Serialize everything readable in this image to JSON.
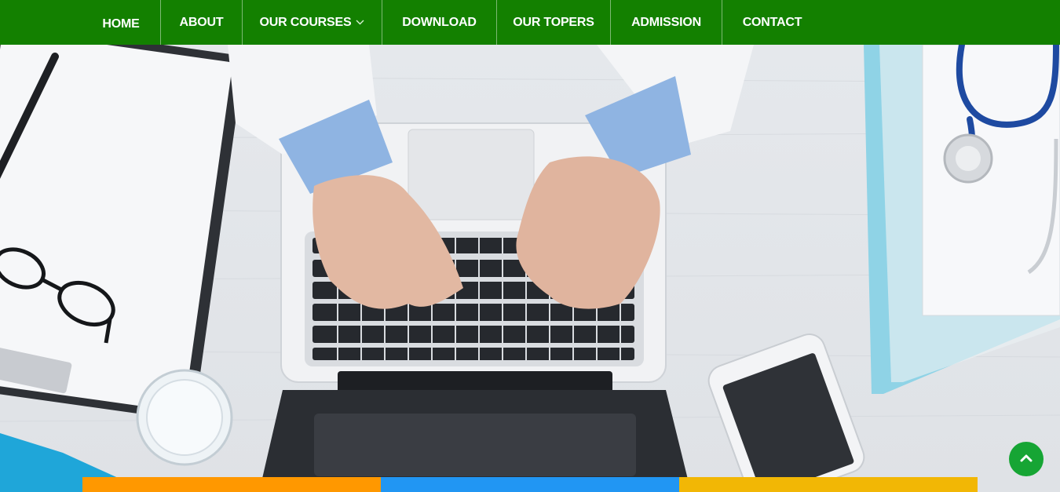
{
  "nav": {
    "items": [
      {
        "label": "HOME"
      },
      {
        "label": "ABOUT"
      },
      {
        "label": "OUR COURSES"
      },
      {
        "label": "DOWNLOAD"
      },
      {
        "label": "OUR TOPERS"
      },
      {
        "label": "ADMISSION"
      },
      {
        "label": "CONTACT"
      }
    ]
  },
  "colors": {
    "nav_bg": "#138000",
    "accent_orange": "#ff9800",
    "accent_blue": "#2196f3",
    "accent_yellow": "#f2b705",
    "scroll_button": "#16a534"
  },
  "icons": {
    "dropdown": "chevron-down-icon",
    "scroll_top": "chevron-up-icon"
  }
}
